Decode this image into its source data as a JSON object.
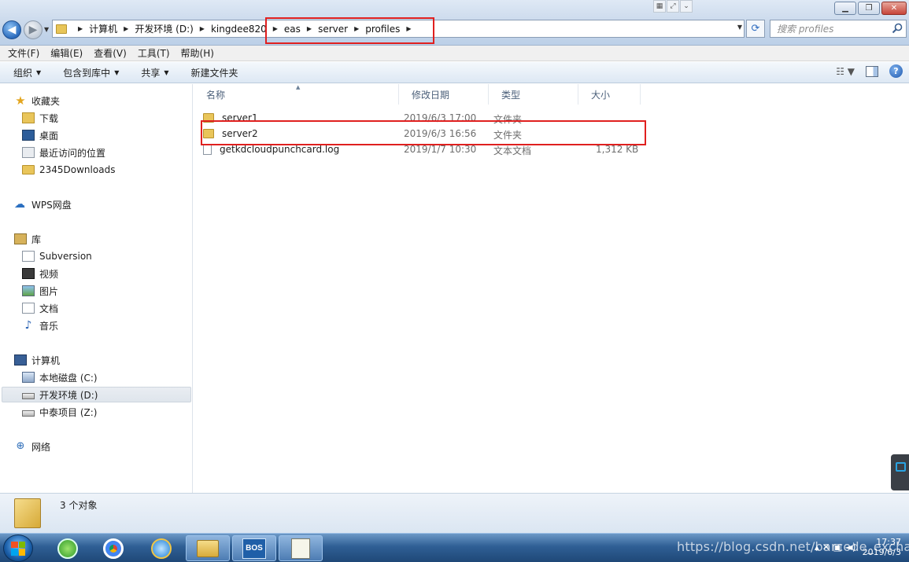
{
  "window": {
    "search_placeholder": "搜索 profiles",
    "breadcrumbs": [
      "计算机",
      "开发环境 (D:)",
      "kingdee820",
      "eas",
      "server",
      "profiles"
    ]
  },
  "menu": [
    "文件(F)",
    "编辑(E)",
    "查看(V)",
    "工具(T)",
    "帮助(H)"
  ],
  "toolbar": {
    "organize": "组织",
    "include_library": "包含到库中",
    "share": "共享",
    "new_folder": "新建文件夹"
  },
  "sidebar": {
    "favorites_label": "收藏夹",
    "favorites": [
      "下载",
      "桌面",
      "最近访问的位置",
      "2345Downloads"
    ],
    "wps_label": "WPS网盘",
    "libraries_label": "库",
    "libraries": [
      "Subversion",
      "视频",
      "图片",
      "文档",
      "音乐"
    ],
    "computer_label": "计算机",
    "drives": [
      "本地磁盘 (C:)",
      "开发环境 (D:)",
      "中泰项目 (Z:)"
    ],
    "network_label": "网络"
  },
  "columns": {
    "name": "名称",
    "modified": "修改日期",
    "type": "类型",
    "size": "大小"
  },
  "files": [
    {
      "name": "server1",
      "modified": "2019/6/3 17:00",
      "type": "文件夹",
      "size": ""
    },
    {
      "name": "server2",
      "modified": "2019/6/3 16:56",
      "type": "文件夹",
      "size": ""
    },
    {
      "name": "getkdcloudpunchcard.log",
      "modified": "2019/1/7 10:30",
      "type": "文本文档",
      "size": "1,312 KB"
    }
  ],
  "details": {
    "count": "3 个对象"
  },
  "taskbar": {
    "time": "17:37",
    "date": "2019/6/3",
    "bos_label": "BOS",
    "watermark": "https://blog.csdn.net/barcode_exchange"
  },
  "colors": {
    "highlight": "#e0201f",
    "accent": "#2a6bbd"
  }
}
